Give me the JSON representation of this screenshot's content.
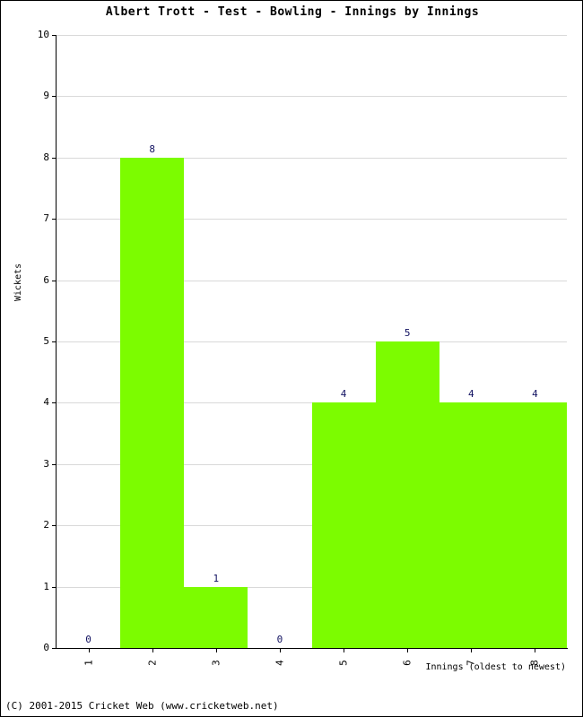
{
  "chart_data": {
    "type": "bar",
    "title": "Albert Trott - Test - Bowling - Innings by Innings",
    "xlabel": "Innings (oldest to newest)",
    "ylabel": "Wickets",
    "categories": [
      "1",
      "2",
      "3",
      "4",
      "5",
      "6",
      "7",
      "8"
    ],
    "values": [
      0,
      8,
      1,
      0,
      4,
      5,
      4,
      4
    ],
    "ylim": [
      0,
      10
    ],
    "ytick_labels": [
      "0",
      "1",
      "2",
      "3",
      "4",
      "5",
      "6",
      "7",
      "8",
      "9",
      "10"
    ],
    "ytick_values": [
      0,
      1,
      2,
      3,
      4,
      5,
      6,
      7,
      8,
      9,
      10
    ],
    "grid": true,
    "legend": null,
    "bar_color": "#7cfc00",
    "value_label_color": "#101060",
    "grid_color": "#d9d9d9",
    "axis_color": "#000000"
  },
  "footer": {
    "credit": "(C) 2001-2015 Cricket Web (www.cricketweb.net)"
  }
}
